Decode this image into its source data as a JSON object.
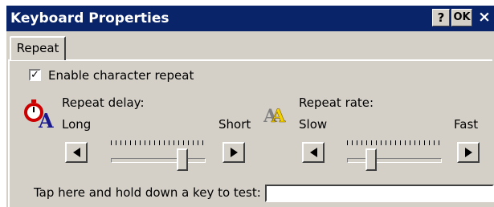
{
  "window": {
    "title": "Keyboard Properties",
    "help_button": "?",
    "ok_button": "OK",
    "close_button": "×"
  },
  "tabs": [
    {
      "label": "Repeat",
      "selected": true
    }
  ],
  "repeat_checkbox": {
    "label": "Enable character repeat",
    "checked": true
  },
  "repeat_delay": {
    "label": "Repeat delay:",
    "min_label": "Long",
    "max_label": "Short",
    "left_arrow": "left-arrow-icon",
    "right_arrow": "right-arrow-icon",
    "value": 0.75
  },
  "repeat_rate": {
    "label": "Repeat rate:",
    "min_label": "Slow",
    "max_label": "Fast",
    "left_arrow": "left-arrow-icon",
    "right_arrow": "right-arrow-icon",
    "value": 0.25
  },
  "test_field": {
    "label": "Tap here and hold down a key to test:",
    "value": ""
  },
  "colors": {
    "titlebar": "#0a246a",
    "face": "#d4d0c8",
    "accent_red": "#cc0000",
    "accent_yellow": "#f2d200"
  }
}
